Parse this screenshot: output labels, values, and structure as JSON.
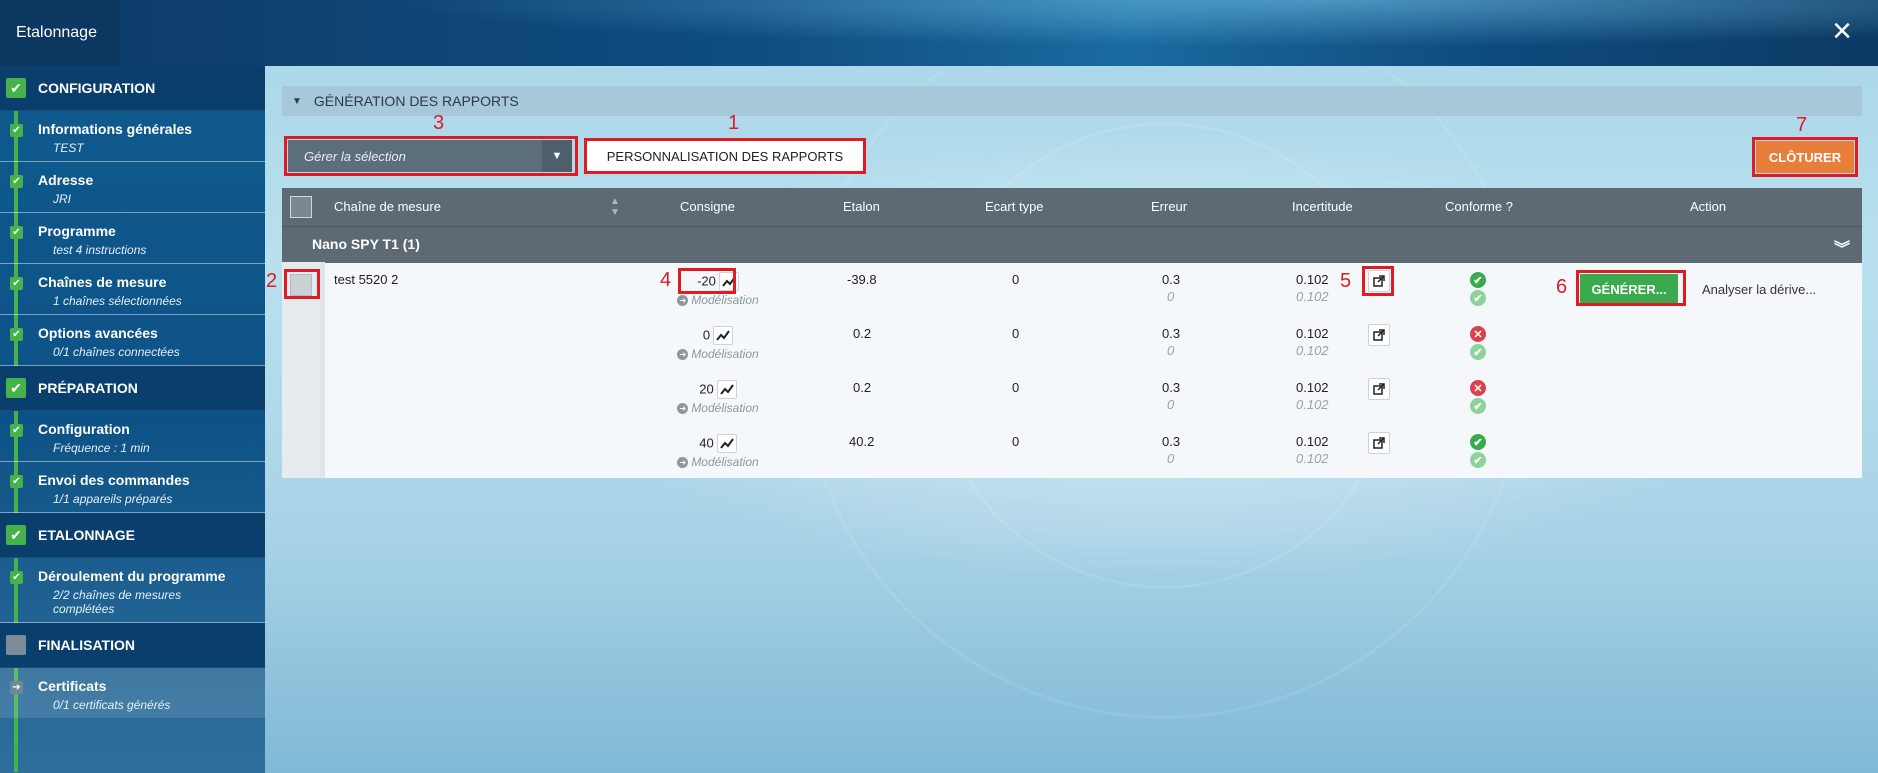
{
  "window": {
    "title": "Etalonnage",
    "close_icon": "×"
  },
  "sidebar": {
    "sections": [
      {
        "title": "CONFIGURATION",
        "status": "done",
        "items": [
          {
            "label": "Informations générales",
            "sub": "TEST"
          },
          {
            "label": "Adresse",
            "sub": "JRI"
          },
          {
            "label": "Programme",
            "sub": "test 4 instructions"
          },
          {
            "label": "Chaînes de mesure",
            "sub": "1 chaînes sélectionnées"
          },
          {
            "label": "Options avancées",
            "sub": "0/1 chaînes connectées"
          }
        ]
      },
      {
        "title": "PRÉPARATION",
        "status": "done",
        "items": [
          {
            "label": "Configuration",
            "sub": "Fréquence : 1 min"
          },
          {
            "label": "Envoi des commandes",
            "sub": "1/1 appareils préparés"
          }
        ]
      },
      {
        "title": "ETALONNAGE",
        "status": "done",
        "items": [
          {
            "label": "Déroulement du programme",
            "sub": "2/2 chaînes de mesures complétées"
          }
        ]
      },
      {
        "title": "FINALISATION",
        "status": "pending",
        "items": [
          {
            "label": "Certificats",
            "sub": "0/1 certificats générés"
          }
        ]
      }
    ]
  },
  "panel": {
    "header": "GÉNÉRATION DES RAPPORTS",
    "select_placeholder": "Gérer la sélection",
    "perso_button": "PERSONNALISATION DES RAPPORTS",
    "close_button": "CLÔTURER"
  },
  "table": {
    "columns": [
      "Chaîne de mesure",
      "Consigne",
      "Etalon",
      "Ecart type",
      "Erreur",
      "Incertitude",
      "Conforme ?",
      "Action"
    ],
    "group": "Nano SPY T1 (1)",
    "chain_name": "test 5520 2",
    "modelisation_label": "Modélisation",
    "rows": [
      {
        "consigne": "-20",
        "etalon": "-39.8",
        "ecart": "0",
        "erreur": "0.3",
        "erreur2": "0",
        "incert": "0.102",
        "incert2": "0.102",
        "conf1": "ok",
        "conf2": "ok"
      },
      {
        "consigne": "0",
        "etalon": "0.2",
        "ecart": "0",
        "erreur": "0.3",
        "erreur2": "0",
        "incert": "0.102",
        "incert2": "0.102",
        "conf1": "ko",
        "conf2": "ok"
      },
      {
        "consigne": "20",
        "etalon": "0.2",
        "ecart": "0",
        "erreur": "0.3",
        "erreur2": "0",
        "incert": "0.102",
        "incert2": "0.102",
        "conf1": "ko",
        "conf2": "ok"
      },
      {
        "consigne": "40",
        "etalon": "40.2",
        "ecart": "0",
        "erreur": "0.3",
        "erreur2": "0",
        "incert": "0.102",
        "incert2": "0.102",
        "conf1": "ok",
        "conf2": "ok"
      }
    ],
    "generate_button": "GÉNÉRER...",
    "analyse_link": "Analyser la dérive..."
  },
  "annotations": [
    "1",
    "2",
    "3",
    "4",
    "5",
    "6",
    "7"
  ],
  "colors": {
    "accent_green": "#3aaa4e",
    "close_orange": "#e77f3b",
    "marker_red": "#e01b24"
  }
}
